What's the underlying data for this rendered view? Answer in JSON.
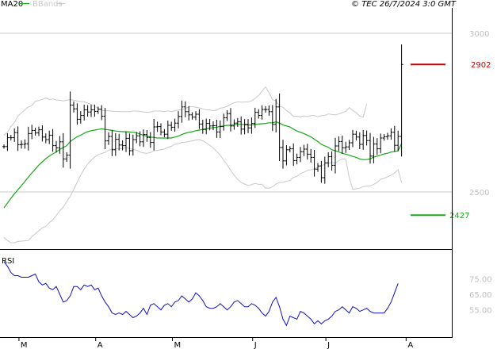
{
  "legend": {
    "ma": {
      "label": "MA20",
      "color": "#18a818"
    },
    "bands": {
      "label": "BBands",
      "color": "#c8c8c8"
    }
  },
  "header": {
    "copyright": "© TEC 26/7/2024 3:0 GMT"
  },
  "colors": {
    "price": "#000000",
    "rsi": "#1010c8",
    "high_marker": "#c80000",
    "low_marker": "#18a818",
    "ref_line": "#c8c8c8",
    "frame": "#000000"
  },
  "chart_data": [
    {
      "type": "ohlc",
      "title": "",
      "ylim": [
        2320,
        3080
      ],
      "y_ticks": [
        {
          "value": 3000,
          "label": "3000"
        },
        {
          "value": 2500,
          "label": "2500"
        }
      ],
      "ref_lines": [
        3000,
        2500
      ],
      "markers": [
        {
          "name": "high",
          "value": 2902,
          "label": "2902"
        },
        {
          "name": "low",
          "value": 2427,
          "label": "2427"
        }
      ],
      "x_months": [
        {
          "label": "M",
          "index": 4.3
        },
        {
          "label": "A",
          "index": 26.3
        },
        {
          "label": "M",
          "index": 48.3
        },
        {
          "label": "J",
          "index": 71.3
        },
        {
          "label": "J",
          "index": 92.3
        },
        {
          "label": "A",
          "index": 115.3
        }
      ],
      "close": [
        2643,
        2671,
        2671,
        2687,
        2649,
        2650,
        2652,
        2684,
        2694,
        2686,
        2696,
        2673,
        2665,
        2679,
        2646,
        2639,
        2658,
        2604,
        2616,
        2774,
        2762,
        2729,
        2741,
        2759,
        2752,
        2759,
        2754,
        2761,
        2739,
        2661,
        2675,
        2633,
        2666,
        2648,
        2646,
        2669,
        2630,
        2665,
        2677,
        2658,
        2681,
        2672,
        2656,
        2705,
        2706,
        2689,
        2682,
        2710,
        2704,
        2717,
        2738,
        2768,
        2753,
        2743,
        2736,
        2745,
        2714,
        2697,
        2716,
        2708,
        2709,
        2689,
        2706,
        2734,
        2747,
        2708,
        2717,
        2721,
        2698,
        2713,
        2702,
        2716,
        2751,
        2741,
        2760,
        2760,
        2753,
        2713,
        2768,
        2640,
        2598,
        2633,
        2636,
        2599,
        2609,
        2627,
        2635,
        2619,
        2609,
        2572,
        2582,
        2545,
        2592,
        2611,
        2584,
        2645,
        2659,
        2639,
        2642,
        2655,
        2682,
        2673,
        2650,
        2678,
        2662,
        2613,
        2651,
        2636,
        2670,
        2674,
        2677,
        2688,
        2647,
        2675,
        2902
      ],
      "ma20": [
        2450,
        2465,
        2480,
        2494,
        2507,
        2520,
        2533,
        2547,
        2560,
        2572,
        2585,
        2595,
        2605,
        2613,
        2620,
        2626,
        2634,
        2640,
        2646,
        2659,
        2667,
        2674,
        2679,
        2685,
        2690,
        2693,
        2695,
        2697,
        2699,
        2697,
        2696,
        2694,
        2692,
        2691,
        2690,
        2690,
        2689,
        2688,
        2687,
        2682,
        2679,
        2676,
        2673,
        2672,
        2670,
        2670,
        2670,
        2670,
        2670,
        2673,
        2676,
        2681,
        2685,
        2688,
        2690,
        2693,
        2695,
        2697,
        2699,
        2701,
        2703,
        2704,
        2707,
        2708,
        2710,
        2710,
        2712,
        2713,
        2713,
        2712,
        2711,
        2711,
        2713,
        2714,
        2715,
        2716,
        2718,
        2718,
        2721,
        2717,
        2711,
        2708,
        2705,
        2698,
        2692,
        2688,
        2684,
        2679,
        2674,
        2666,
        2659,
        2650,
        2645,
        2641,
        2633,
        2630,
        2626,
        2622,
        2619,
        2616,
        2612,
        2609,
        2604,
        2602,
        2602,
        2604,
        2610,
        2613,
        2616,
        2620,
        2622,
        2626,
        2627,
        2630,
        2652
      ],
      "bb_upper": [
        2679,
        2688,
        2706,
        2719,
        2739,
        2749,
        2759,
        2768,
        2772,
        2786,
        2788,
        2792,
        2796,
        2791,
        2793,
        2790,
        2789,
        2787,
        2789,
        2791,
        2789,
        2787,
        2785,
        2784,
        2780,
        2776,
        2770,
        2763,
        2757,
        2756,
        2756,
        2754,
        2754,
        2753,
        2753,
        2753,
        2753,
        2755,
        2755,
        2754,
        2752,
        2751,
        2752,
        2755,
        2755,
        2755,
        2753,
        2756,
        2753,
        2756,
        2758,
        2760,
        2763,
        2768,
        2769,
        2767,
        2765,
        2762,
        2759,
        2758,
        2756,
        2758,
        2764,
        2766,
        2770,
        2776,
        2781,
        2784,
        2783,
        2783,
        2784,
        2787,
        2795,
        2804,
        2818,
        2831,
        2813,
        2791,
        2787,
        2770,
        2767,
        2756,
        2749,
        2738,
        2739,
        2736,
        2740,
        2737,
        2741,
        2741,
        2737,
        2741,
        2741,
        2746,
        2744,
        2743,
        2746,
        2750,
        2754,
        2766,
        2757,
        2750,
        2739,
        2736,
        2777
      ],
      "bb_lower": [
        2357,
        2347,
        2340,
        2340,
        2344,
        2345,
        2346,
        2347,
        2359,
        2368,
        2378,
        2387,
        2392,
        2403,
        2412,
        2426,
        2440,
        2452,
        2470,
        2486,
        2508,
        2531,
        2553,
        2572,
        2588,
        2600,
        2610,
        2618,
        2621,
        2625,
        2632,
        2634,
        2636,
        2636,
        2637,
        2640,
        2637,
        2634,
        2632,
        2626,
        2623,
        2622,
        2624,
        2630,
        2631,
        2633,
        2635,
        2641,
        2644,
        2650,
        2652,
        2656,
        2657,
        2659,
        2661,
        2664,
        2665,
        2661,
        2655,
        2647,
        2639,
        2627,
        2616,
        2600,
        2585,
        2568,
        2553,
        2540,
        2530,
        2525,
        2520,
        2523,
        2527,
        2524,
        2524,
        2512,
        2512,
        2516,
        2525,
        2530,
        2530,
        2534,
        2536,
        2546,
        2549,
        2558,
        2562,
        2568,
        2570,
        2573,
        2578,
        2582,
        2588,
        2590,
        2593,
        2591,
        2599,
        2604,
        2603,
        2545,
        2508,
        2510,
        2512,
        2517,
        2518,
        2519,
        2524,
        2530,
        2540,
        2543,
        2548,
        2553,
        2560,
        2570,
        2530
      ]
    },
    {
      "type": "line",
      "name": "RSI",
      "ylim": [
        38,
        90
      ],
      "y_ticks": [
        {
          "value": 75,
          "label": "75.00"
        },
        {
          "value": 65,
          "label": "65.00"
        },
        {
          "value": 55,
          "label": "55.00"
        }
      ],
      "values": [
        86,
        83,
        79,
        77,
        77,
        76,
        76,
        76,
        77,
        78,
        73,
        71,
        72,
        69,
        68,
        70,
        65,
        60,
        61,
        64,
        70,
        70,
        68,
        71,
        70,
        71,
        68,
        69,
        64,
        60,
        57,
        53,
        52,
        53,
        52,
        54,
        52,
        50,
        51,
        53,
        56,
        52,
        58,
        59,
        57,
        55,
        58,
        59,
        57,
        60,
        61,
        64,
        62,
        60,
        62,
        66,
        64,
        61,
        57,
        56,
        56,
        57,
        59,
        57,
        55,
        57,
        60,
        61,
        59,
        57,
        57,
        59,
        58,
        56,
        53,
        51,
        54,
        60,
        63,
        57,
        49,
        45,
        51,
        50,
        49,
        54,
        53,
        51,
        49,
        46,
        48,
        46,
        48,
        49,
        51,
        54,
        55,
        57,
        55,
        53,
        57,
        56,
        54,
        55,
        56,
        54,
        53,
        53,
        53,
        53,
        56,
        60,
        66,
        72
      ]
    }
  ]
}
